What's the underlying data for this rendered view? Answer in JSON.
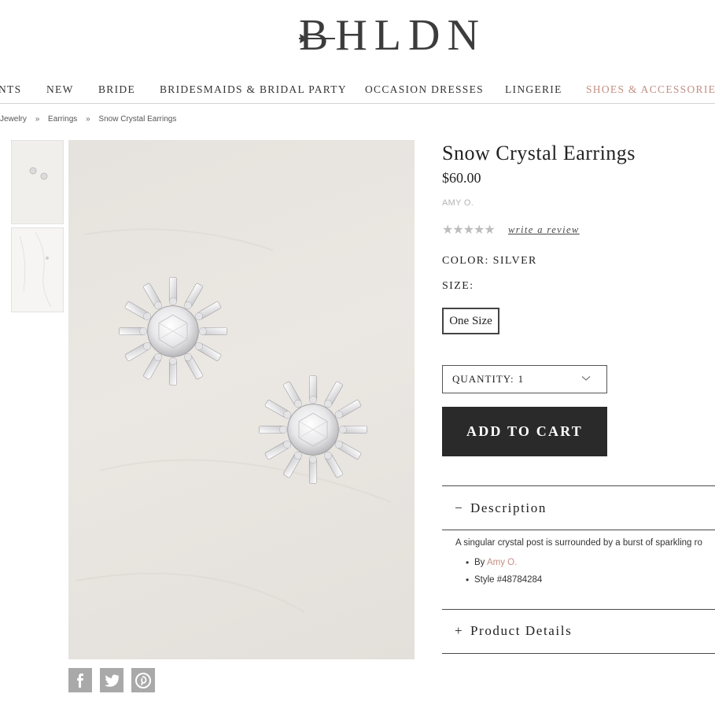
{
  "brand": {
    "logo": "BHLDN"
  },
  "nav": {
    "items": [
      {
        "label": "NTS"
      },
      {
        "label": "NEW"
      },
      {
        "label": "BRIDE"
      },
      {
        "label": "BRIDESMAIDS & BRIDAL PARTY"
      },
      {
        "label": "OCCASION DRESSES"
      },
      {
        "label": "LINGERIE"
      },
      {
        "label": "SHOES & ACCESSORIES",
        "accent": true
      }
    ]
  },
  "breadcrumb": {
    "items": [
      "Jewelry",
      "Earrings",
      "Snow Crystal Earrings"
    ],
    "separator": "»"
  },
  "gallery": {
    "thumbnails": [
      "earrings-thumbnail",
      "earrings-on-model-thumbnail"
    ]
  },
  "social": {
    "items": [
      "facebook-icon",
      "twitter-icon",
      "pinterest-icon"
    ]
  },
  "product": {
    "title": "Snow Crystal Earrings",
    "price": "$60.00",
    "designer": "AMY O.",
    "rating_stars": "★★★★★",
    "review_link": "write a review",
    "color_label": "COLOR: SILVER",
    "size_label": "SIZE:",
    "size_option": "One Size",
    "quantity_label": "QUANTITY:",
    "quantity_value": "1",
    "add_to_cart": "ADD TO CART"
  },
  "description": {
    "sign": "−",
    "heading": "Description",
    "text": "A singular crystal post is surrounded by a burst of sparkling ro",
    "by_prefix": "By",
    "by_designer": "Amy O.",
    "style": "Style #48784284"
  },
  "details": {
    "sign": "+",
    "heading": "Product Details"
  },
  "colors": {
    "accent": "#c38f84",
    "cart_bg": "#2a2a2a",
    "star": "#bdbdbd"
  }
}
